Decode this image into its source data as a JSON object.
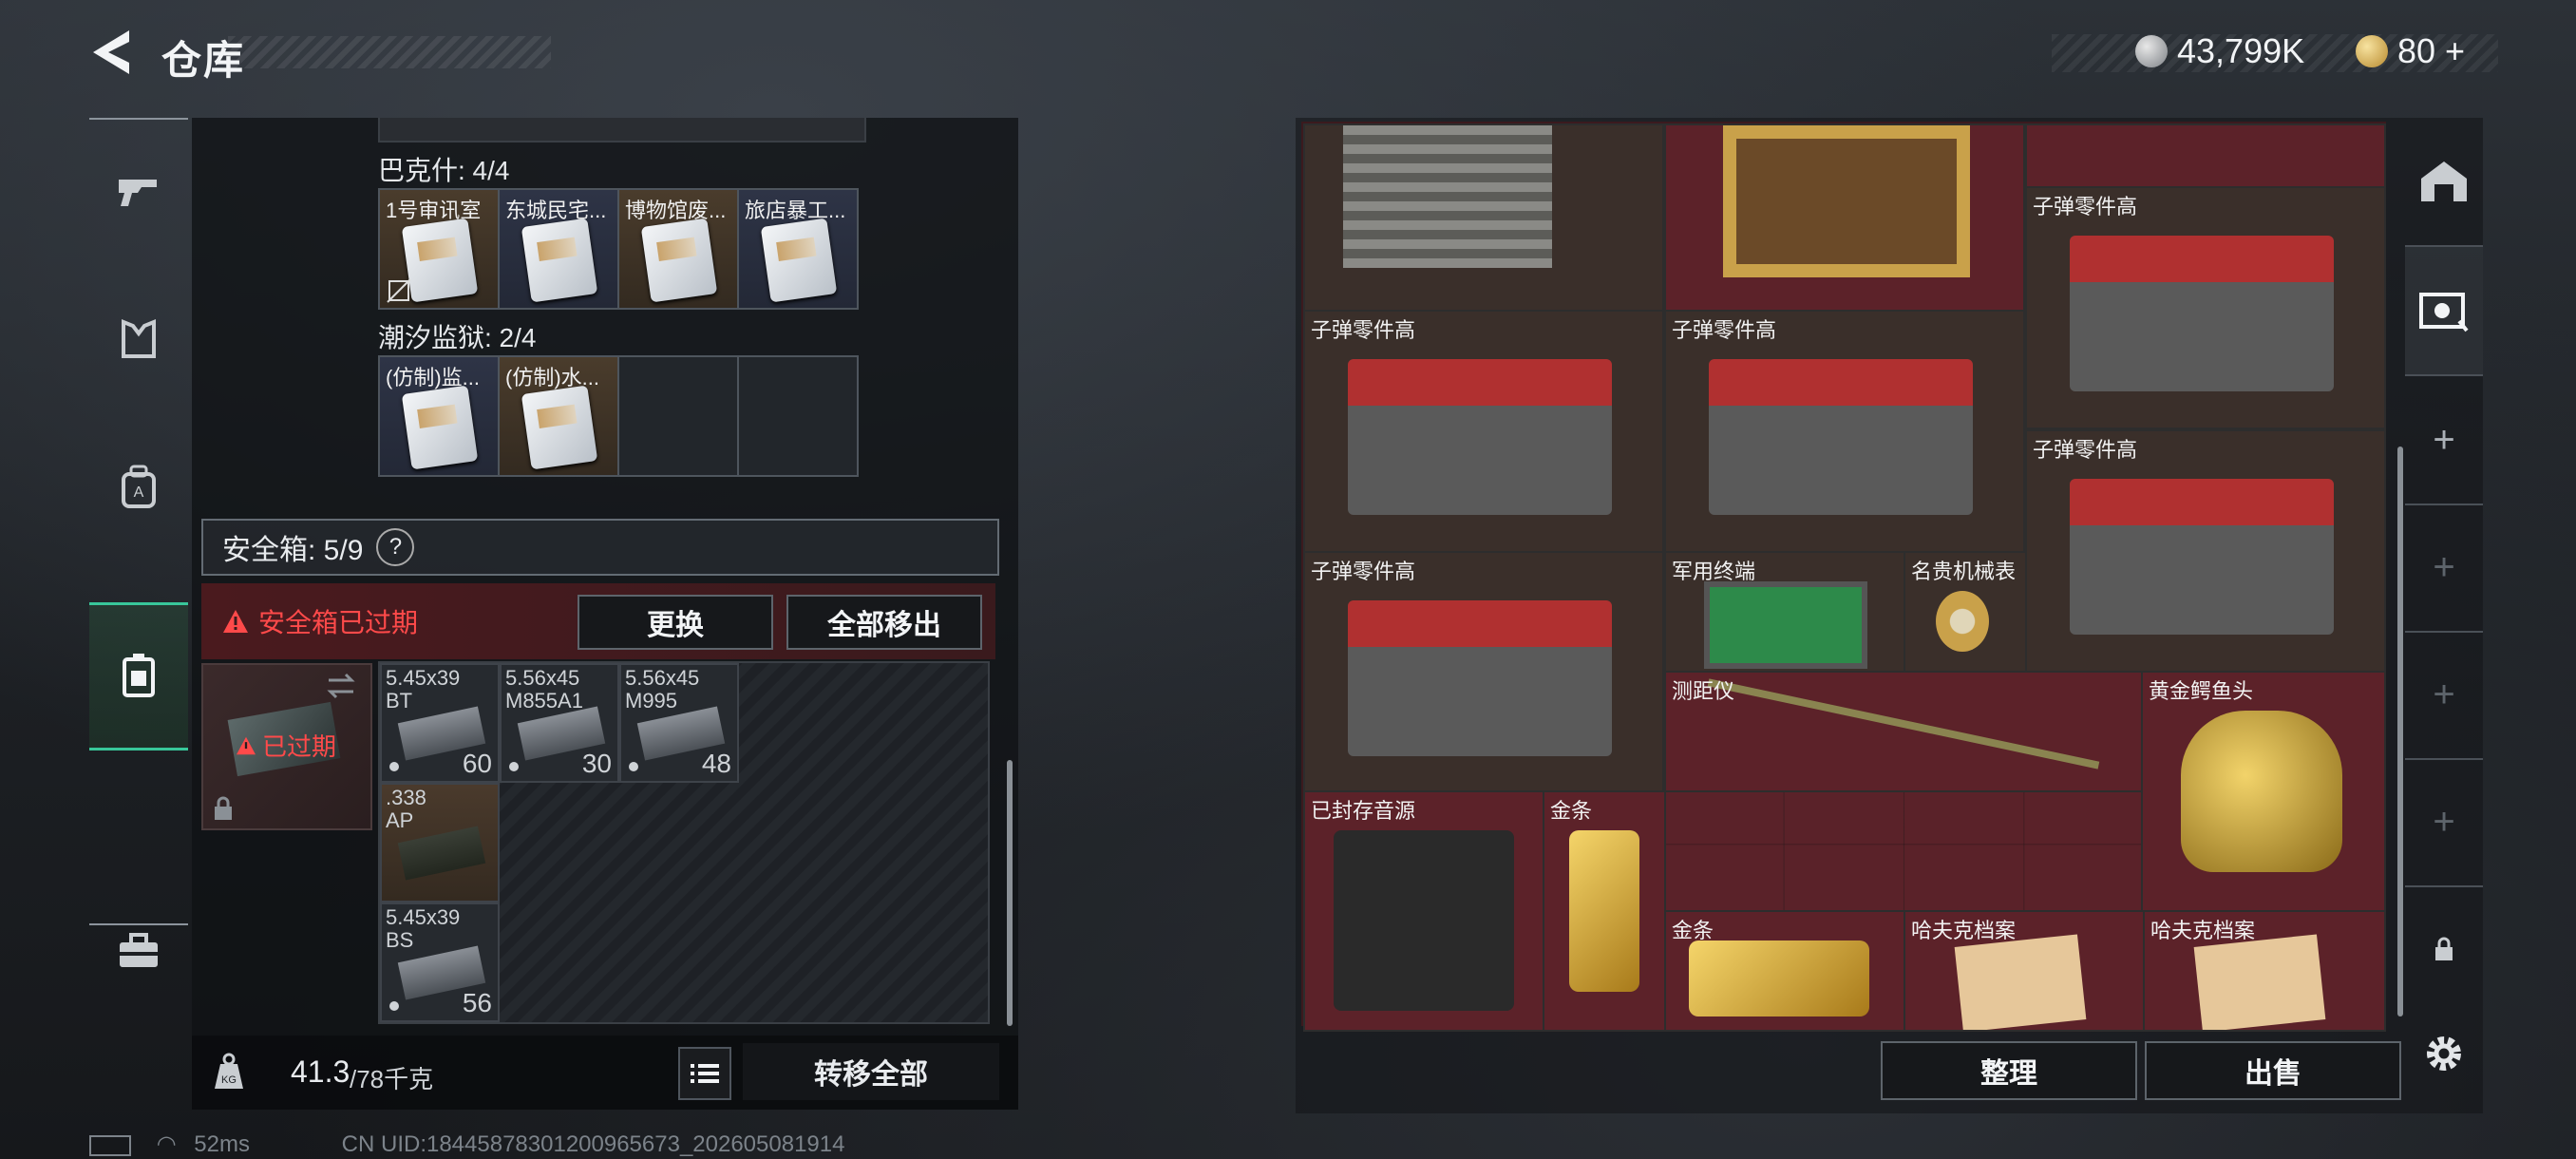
{
  "header": {
    "title": "仓库"
  },
  "currency": {
    "silver": "43,799K",
    "gold": "80",
    "plus": "+"
  },
  "left_nav": [
    "gun-icon",
    "armor-icon",
    "backpack-icon",
    "safebox-icon",
    "toolbox-icon"
  ],
  "keys": {
    "group1_label": "巴克什: 4/4",
    "group1": [
      "1号审讯室",
      "东城民宅...",
      "博物馆废...",
      "旅店暴工..."
    ],
    "group2_label": "潮汐监狱: 2/4",
    "group2": [
      "(仿制)监...",
      "(仿制)水..."
    ]
  },
  "safebox": {
    "label": "安全箱: 5/9",
    "help": "?",
    "warning": "安全箱已过期",
    "replace_button": "更换",
    "remove_all_button": "全部移出",
    "expired_tag": "已过期"
  },
  "ammo": [
    {
      "name": "5.45x39\nBT",
      "count": "60"
    },
    {
      "name": "5.56x45\nM855A1",
      "count": "30"
    },
    {
      "name": "5.56x45\nM995",
      "count": "48"
    },
    {
      "name": ".338\nAP",
      "count": ""
    },
    {
      "name": "5.45x39\nBS",
      "count": "56"
    }
  ],
  "weight": {
    "current": "41.3",
    "max": "/78千克"
  },
  "transfer_all_button": "转移全部",
  "storage_items": [
    {
      "label": "子弹零件高"
    },
    {
      "label": "子弹零件高"
    },
    {
      "label": "子弹零件高"
    },
    {
      "label": "子弹零件高"
    },
    {
      "label": "子弹零件高"
    },
    {
      "label": "军用终端"
    },
    {
      "label": "名贵机械表"
    },
    {
      "label": "测距仪"
    },
    {
      "label": "黄金鳄鱼头"
    },
    {
      "label": "已封存音源"
    },
    {
      "label": "金条"
    },
    {
      "label": "金条"
    },
    {
      "label": "哈夫克档案"
    },
    {
      "label": "哈夫克档案"
    }
  ],
  "organize_button": "整理",
  "sell_button": "出售",
  "status": {
    "ping": "52ms",
    "uid": "CN UID:18445878301200965673_202605081914"
  }
}
